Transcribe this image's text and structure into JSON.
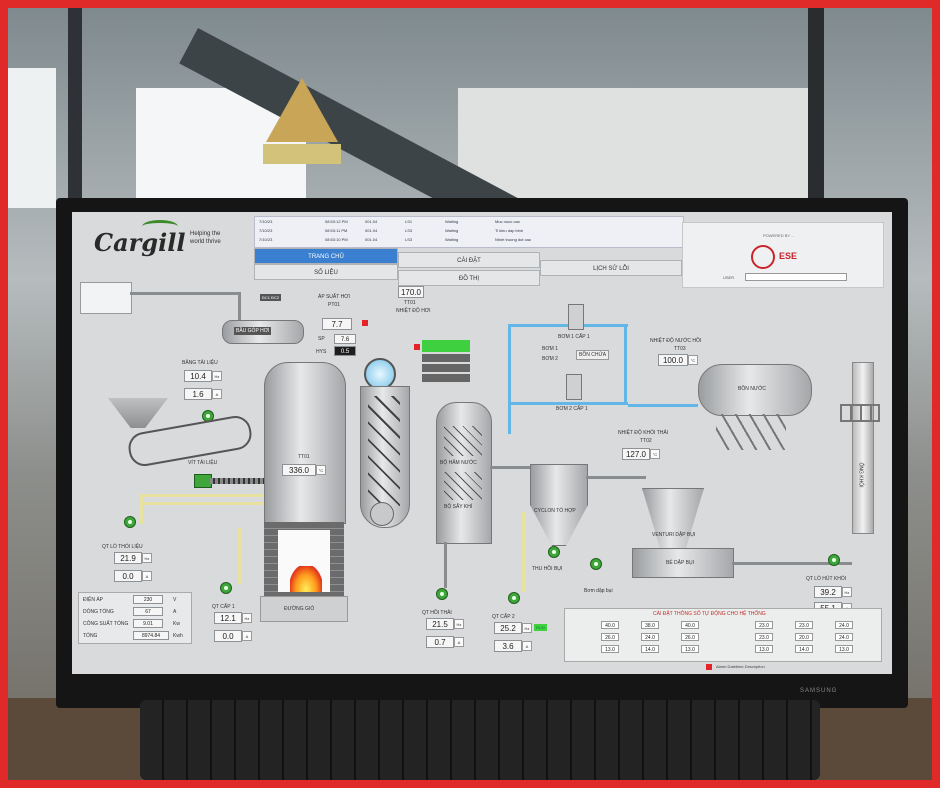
{
  "header": {
    "logo": "Cargill",
    "tagline": "Helping the world thrive"
  },
  "alarms": [
    {
      "date": "7/10/23",
      "time": "08:53:12 PM",
      "value": "001.04",
      "code": "LS1",
      "state": "Waiting",
      "msg": "Muc nuoc cao"
    },
    {
      "date": "7/10/23",
      "time": "08:53:11 PM",
      "value": "001.04",
      "code": "LS3",
      "state": "Waiting",
      "msg": "Ti kieu dap binh"
    },
    {
      "date": "7/10/23",
      "time": "08:53:10 PM",
      "value": "001.04",
      "code": "LS3",
      "state": "Waiting",
      "msg": "Nhiet truong dot cao"
    }
  ],
  "nav": {
    "tab1": "TRANG CHỦ",
    "tab2": "CÀI ĐẶT",
    "tab3": "SỐ LIỆU",
    "tab4": "ĐỒ THỊ",
    "tab5": "LỊCH SỬ LỖI"
  },
  "brand": {
    "caption": "POWERED BY ...",
    "name": "ESE",
    "label": "USER"
  },
  "process": {
    "mau_dop_hoi": "BẦU GÓP HƠI",
    "ap_suat_hoi_label": "ÁP SUẤT HƠI",
    "ap_suat_hoi_sub": "PT01",
    "ap_suat_hoi_value": "7.7",
    "sp_label": "SP",
    "sp_value": "7.6",
    "hys_label": "HYS",
    "hys_value": "0.5",
    "top_value": "170.0",
    "nhiet_do_hoi_label": "NHIỆT ĐỘ HƠI",
    "nhiet_do_hoi_sub": "TT01",
    "bang_tai_label": "BĂNG TẢI LIỆU",
    "bang_tai_value1": "10.4",
    "bang_tai_value2": "1.6",
    "vit_tai_label": "VÍT TẢI LIỆU",
    "t_buong_dot_label": "TT01",
    "t_buong_dot_value": "336.0",
    "qt_thoi_lieu_label": "QT LÒ THỔI LIỆU",
    "qt_thoi_lieu_value1": "21.9",
    "qt_thoi_lieu_value2": "0.0",
    "qt_cap1_label": "QT CẤP 1",
    "qt_cap1_value1": "12.1",
    "qt_cap1_value2": "0.0",
    "duong_gio_label": "ĐƯỜNG GIÓ",
    "qt_hoi_thai_label": "QT HỒI THẢI",
    "qt_hoi_thai_value1": "21.5",
    "qt_hoi_thai_value2": "0.7",
    "qt_cap2_label": "QT CẤP 2",
    "qt_cap2_value1": "25.2",
    "qt_cap2_value2": "3.6",
    "qt_cap2_flag": "RUN",
    "bo_ham_nuoc": "BỘ HÂM NƯỚC",
    "bo_say_khi": "BỘ SẤY KHÍ",
    "cyclon_label": "CYCLON TỔ HỢP",
    "thu_hoi_bui": "THU HỒI BỤI",
    "venturi_label": "VENTURI DẬP BỤI",
    "be_dap_bui": "BỂ DẬP BỤI",
    "bom_dap_bui": "Bơm dập bụi",
    "nhiet_do_khoi_label": "NHIỆT ĐỘ KHÓI THẢI",
    "nhiet_do_khoi_sub": "TT02",
    "nhiet_do_khoi_value": "127.0",
    "nhiet_do_nuoc_label": "NHIỆT ĐỘ NƯỚC HỒI",
    "nhiet_do_nuoc_sub": "TT03",
    "nhiet_do_nuoc_value": "100.0",
    "bon_nuoc_label": "BỒN NƯỚC",
    "bom1_label": "BƠM 1 CẤP 1",
    "bom2_label": "BƠM 2 CẤP 1",
    "bom_label_a": "BƠM 1",
    "bom_label_b": "BƠM 2",
    "bon_chua": "BỒN CHỨA",
    "qt_hut_khoi_label": "QT LÒ HÚT KHÓI",
    "qt_hut_khoi_value1": "39.2",
    "qt_hut_khoi_value2": "55.1",
    "ong_khoi": "ỐNG KHÓI"
  },
  "info_panel": {
    "rows": [
      {
        "label": "ĐIỆN ÁP",
        "value": "230",
        "unit": "V"
      },
      {
        "label": "DÒNG TỔNG",
        "value": "67",
        "unit": "A"
      },
      {
        "label": "CÔNG SUẤT TỔNG",
        "value": "9.01",
        "unit": "Kw"
      },
      {
        "label": "TỔNG",
        "value": "8974.84",
        "unit": "Kwh"
      }
    ]
  },
  "status_table": {
    "title": "CÀI ĐẶT THÔNG SỐ TỰ ĐỘNG CHO HỆ THỐNG",
    "left": [
      {
        "v1": "40.0",
        "v2": "38.0",
        "v3": "40.0"
      },
      {
        "v1": "26.0",
        "v2": "24.0",
        "v3": "26.0"
      },
      {
        "v1": "13.0",
        "v2": "14.0",
        "v3": "13.0"
      }
    ],
    "right": [
      {
        "v1": "23.0",
        "v2": "23.0",
        "v3": "24.0"
      },
      {
        "v1": "23.0",
        "v2": "20.0",
        "v3": "24.0"
      },
      {
        "v1": "13.0",
        "v2": "14.0",
        "v3": "13.0"
      }
    ]
  },
  "footer": {
    "text": "Alarm  Datetime  Description"
  }
}
